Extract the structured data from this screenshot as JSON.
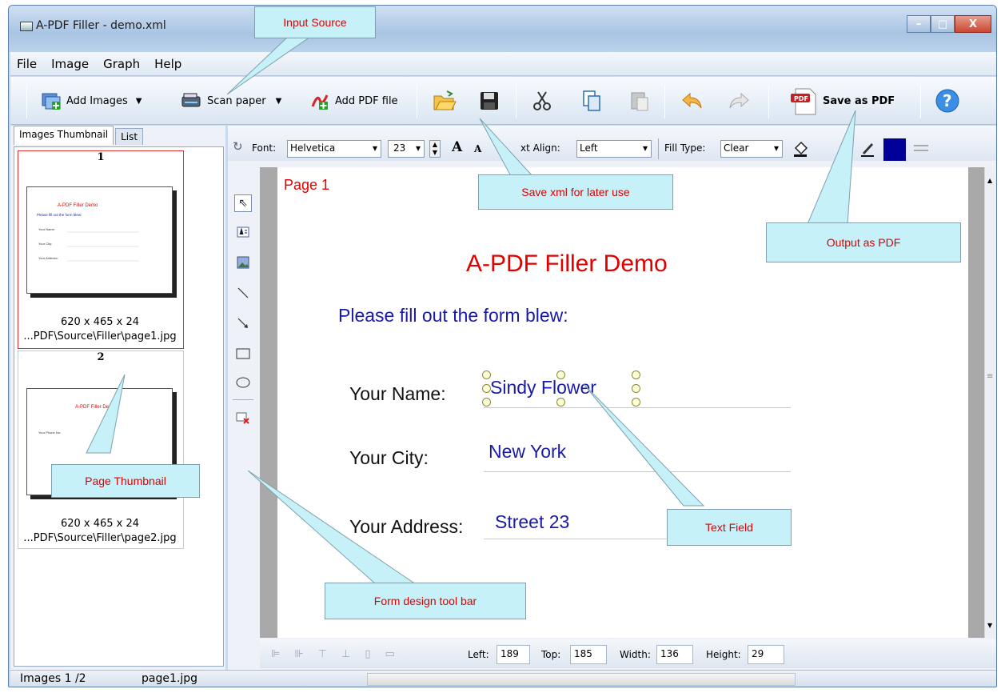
{
  "window": {
    "title": "A-PDF Filler - demo.xml",
    "minimize": "–",
    "maximize": "□",
    "close": "X"
  },
  "menu": [
    "File",
    "Image",
    "Graph",
    "Help"
  ],
  "toolbar": {
    "add_images": "Add Images",
    "scan_paper": "Scan paper",
    "add_pdf": "Add PDF file",
    "save_as_pdf": "Save as PDF",
    "arrow": "▼"
  },
  "left_panel": {
    "tabs": [
      "Images Thumbnail",
      "List"
    ],
    "thumbnails": [
      {
        "number": "1",
        "size": "620 x 465 x 24",
        "path": "...PDF\\Source\\Filler\\page1.jpg"
      },
      {
        "number": "2",
        "size": "620 x 465 x 24",
        "path": "...PDF\\Source\\Filler\\page2.jpg"
      }
    ]
  },
  "format_bar": {
    "font_label": "Font:",
    "font_value": "Helvetica",
    "font_size": "23",
    "grow_font": "A",
    "shrink_font": "A",
    "text_align_label": "xt Align:",
    "text_align_value": "Left",
    "fill_type_label": "Fill Type:",
    "fill_type_value": "Clear",
    "fill_color": "#000099"
  },
  "page": {
    "page_label": "Page 1",
    "title": "A-PDF Filler Demo",
    "instruction": "Please fill out the form blew:",
    "fields": [
      {
        "label": "Your Name:",
        "value": "Sindy Flower"
      },
      {
        "label": "Your City:",
        "value": "New York"
      },
      {
        "label": "Your Address:",
        "value": "Street 23"
      }
    ]
  },
  "position_bar": {
    "left_label": "Left:",
    "left": "189",
    "top_label": "Top:",
    "top": "185",
    "width_label": "Width:",
    "width": "136",
    "height_label": "Height:",
    "height": "29"
  },
  "status": {
    "images": "Images 1 /2",
    "file": "page1.jpg"
  },
  "callouts": {
    "input_source": "Input Source",
    "save_xml": "Save xml for later use",
    "output_pdf": "Output as PDF",
    "page_thumbnail": "Page Thumbnail",
    "text_field": "Text Field",
    "form_design": "Form design tool bar"
  },
  "colors": {
    "title_red": "#e00000",
    "form_blue": "#1a1aa8",
    "callout_bg": "#c6f1f9"
  }
}
